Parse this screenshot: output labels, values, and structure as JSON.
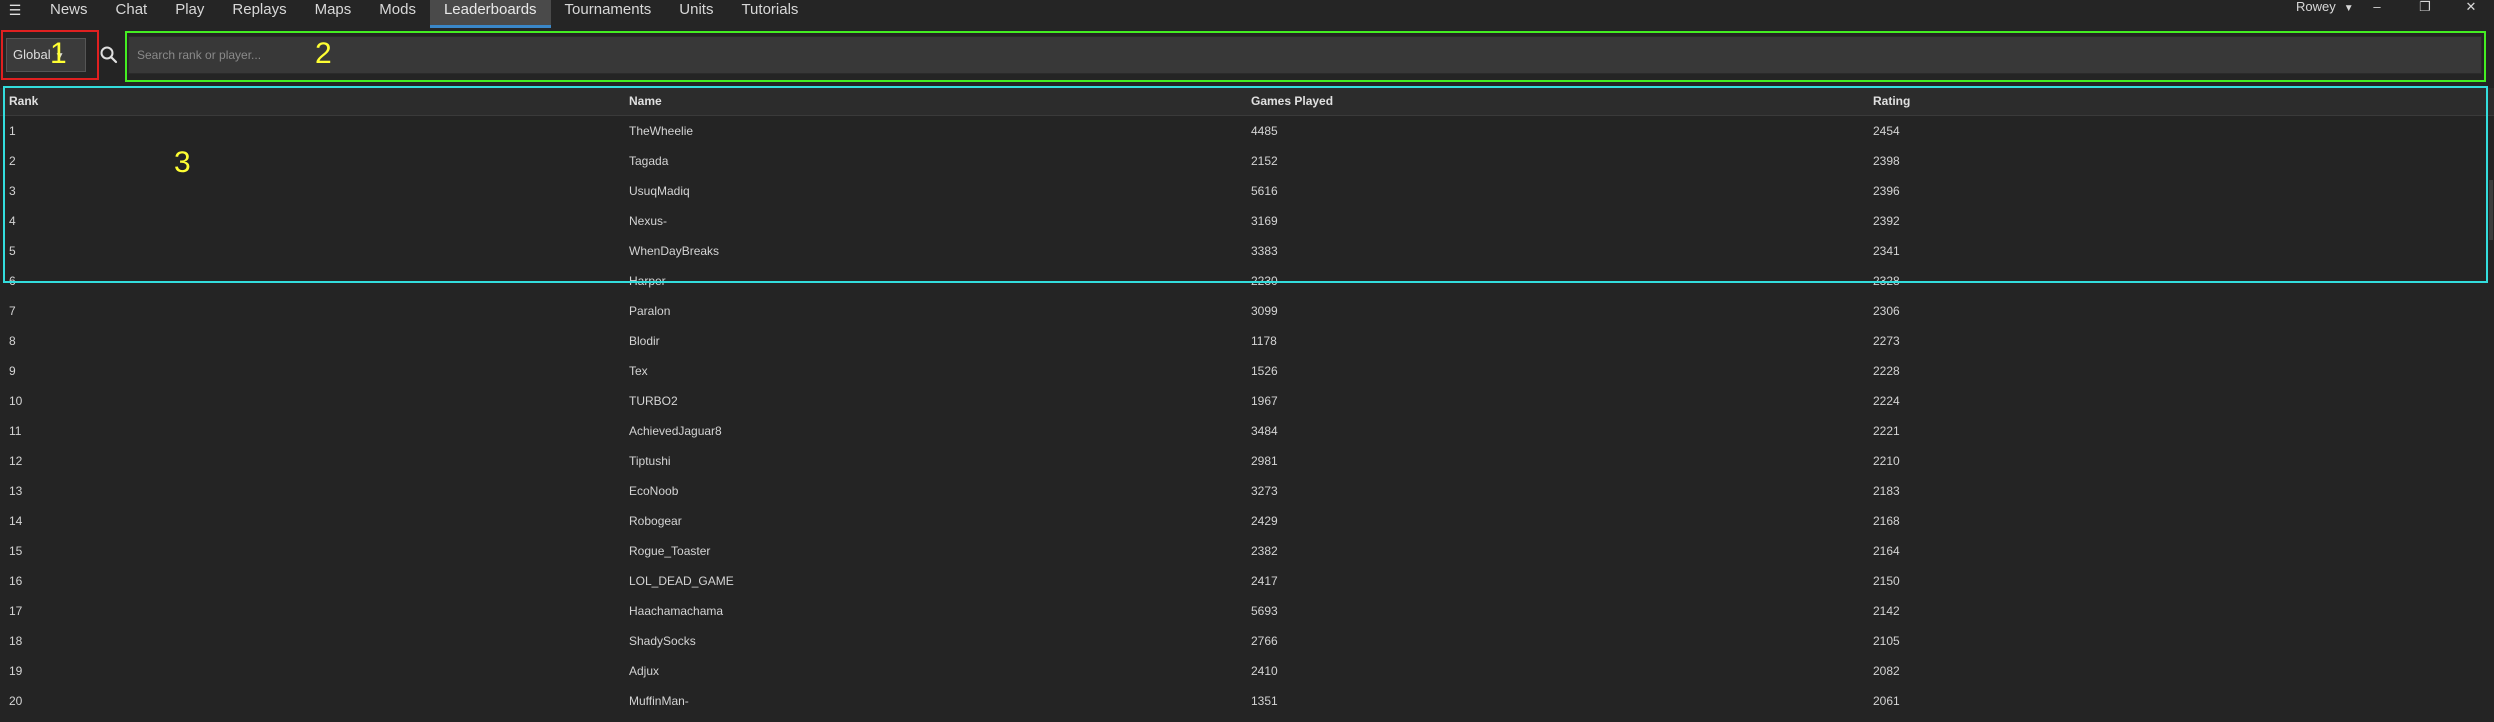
{
  "nav": {
    "menu_icon": "hamburger-icon",
    "tabs": [
      {
        "label": "News"
      },
      {
        "label": "Chat"
      },
      {
        "label": "Play"
      },
      {
        "label": "Replays"
      },
      {
        "label": "Maps"
      },
      {
        "label": "Mods"
      },
      {
        "label": "Leaderboards",
        "active": true
      },
      {
        "label": "Tournaments"
      },
      {
        "label": "Units"
      },
      {
        "label": "Tutorials"
      }
    ],
    "user": "Rowey",
    "accent_color": "#3a87c8"
  },
  "window_controls": {
    "minimize": "–",
    "restore": "❐",
    "close": "✕"
  },
  "filter": {
    "selected": "Global",
    "search_placeholder": "Search rank or player...",
    "search_value": ""
  },
  "annotations": [
    {
      "label": "1",
      "color": "#e02020"
    },
    {
      "label": "2",
      "color": "#44ee22"
    },
    {
      "label": "3",
      "color": "#33dddd"
    }
  ],
  "table": {
    "columns": [
      "Rank",
      "Name",
      "Games Played",
      "Rating"
    ],
    "rows": [
      [
        "1",
        "TheWheelie",
        "4485",
        "2454"
      ],
      [
        "2",
        "Tagada",
        "2152",
        "2398"
      ],
      [
        "3",
        "UsuqMadiq",
        "5616",
        "2396"
      ],
      [
        "4",
        "Nexus-",
        "3169",
        "2392"
      ],
      [
        "5",
        "WhenDayBreaks",
        "3383",
        "2341"
      ],
      [
        "6",
        "Harper",
        "2230",
        "2328"
      ],
      [
        "7",
        "Paralon",
        "3099",
        "2306"
      ],
      [
        "8",
        "Blodir",
        "1178",
        "2273"
      ],
      [
        "9",
        "Tex",
        "1526",
        "2228"
      ],
      [
        "10",
        "TURBO2",
        "1967",
        "2224"
      ],
      [
        "11",
        "AchievedJaguar8",
        "3484",
        "2221"
      ],
      [
        "12",
        "Tiptushi",
        "2981",
        "2210"
      ],
      [
        "13",
        "EcoNoob",
        "3273",
        "2183"
      ],
      [
        "14",
        "Robogear",
        "2429",
        "2168"
      ],
      [
        "15",
        "Rogue_Toaster",
        "2382",
        "2164"
      ],
      [
        "16",
        "LOL_DEAD_GAME",
        "2417",
        "2150"
      ],
      [
        "17",
        "Haachamachama",
        "5693",
        "2142"
      ],
      [
        "18",
        "ShadySocks",
        "2766",
        "2105"
      ],
      [
        "19",
        "Adjux",
        "2410",
        "2082"
      ],
      [
        "20",
        "MuffinMan-",
        "1351",
        "2061"
      ]
    ]
  }
}
